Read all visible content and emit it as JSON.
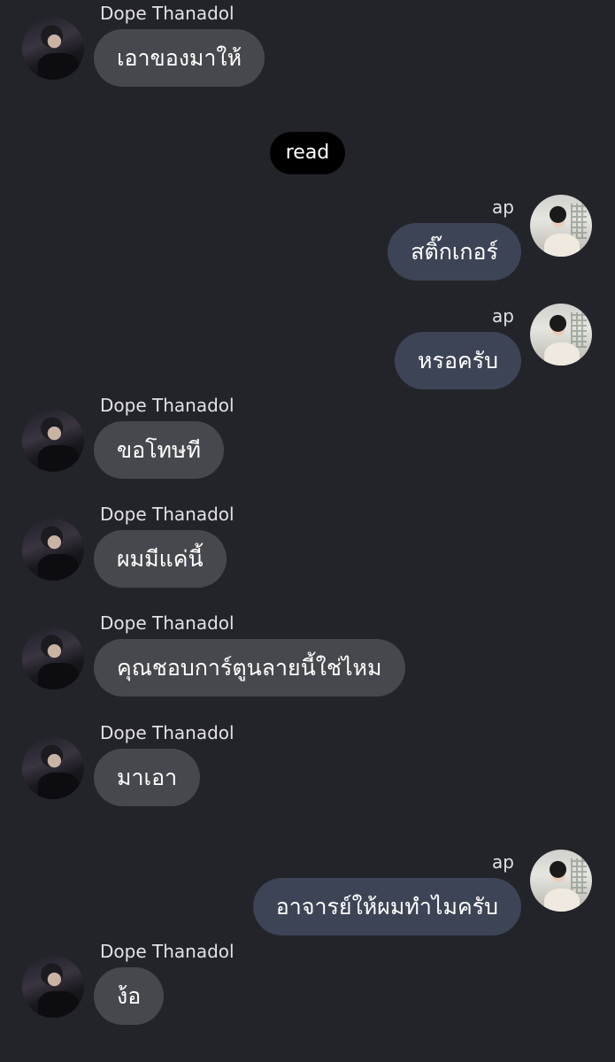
{
  "chat": {
    "read_label": "read",
    "messages": [
      {
        "direction": "in",
        "sender": "Dope Thanadol",
        "text": "เอาของมาให้"
      },
      {
        "direction": "out",
        "sender": "ap",
        "text": "สติ๊กเกอร์"
      },
      {
        "direction": "out",
        "sender": "ap",
        "text": "หรอครับ"
      },
      {
        "direction": "in",
        "sender": "Dope Thanadol",
        "text": "ขอโทษที"
      },
      {
        "direction": "in",
        "sender": "Dope Thanadol",
        "text": "ผมมีแค่นี้"
      },
      {
        "direction": "in",
        "sender": "Dope Thanadol",
        "text": "คุณชอบการ์ตูนลายนี้ใช่ไหม"
      },
      {
        "direction": "in",
        "sender": "Dope Thanadol",
        "text": "มาเอา"
      },
      {
        "direction": "out",
        "sender": "ap",
        "text": "อาจารย์ให้ผมทำไมครับ"
      },
      {
        "direction": "in",
        "sender": "Dope Thanadol",
        "text": "ง้อ"
      }
    ]
  }
}
